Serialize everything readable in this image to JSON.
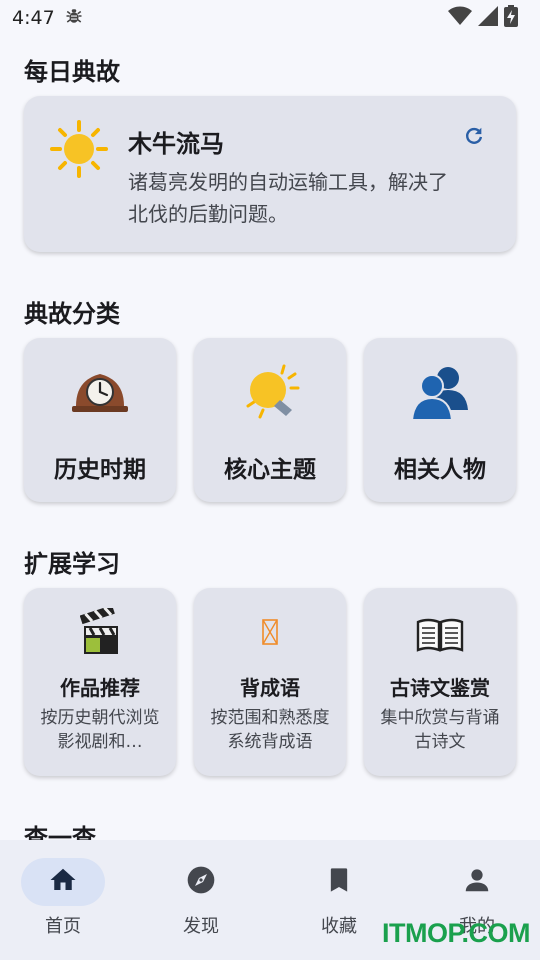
{
  "status_bar": {
    "time": "4:47",
    "icons": [
      "bug-icon",
      "wifi-icon",
      "signal-icon",
      "battery-charging-icon"
    ]
  },
  "daily": {
    "section_title": "每日典故",
    "title": "木牛流马",
    "description": "诸葛亮发明的自动运输工具，解决了北伐的后勤问题。",
    "icon": "sun-icon",
    "refresh_icon": "refresh-icon"
  },
  "categories": {
    "section_title": "典故分类",
    "items": [
      {
        "label": "历史时期",
        "icon": "mantel-clock-icon"
      },
      {
        "label": "核心主题",
        "icon": "light-bulb-icon"
      },
      {
        "label": "相关人物",
        "icon": "people-icon"
      }
    ]
  },
  "extended": {
    "section_title": "扩展学习",
    "items": [
      {
        "label": "作品推荐",
        "description": "按历史朝代浏览影视剧和…",
        "icon": "clapper-board-icon"
      },
      {
        "label": "背成语",
        "description": "按范围和熟悉度系统背成语",
        "icon": "hourglass-icon"
      },
      {
        "label": "古诗文鉴赏",
        "description": "集中欣赏与背诵古诗文",
        "icon": "open-book-icon"
      }
    ]
  },
  "lookup": {
    "section_title": "查一查"
  },
  "bottom_nav": {
    "items": [
      {
        "label": "首页",
        "icon": "home-icon",
        "active": true
      },
      {
        "label": "发现",
        "icon": "compass-icon",
        "active": false
      },
      {
        "label": "收藏",
        "icon": "bookmark-icon",
        "active": false
      },
      {
        "label": "我的",
        "icon": "person-icon",
        "active": false
      }
    ]
  },
  "watermark": "ITMOP.COM",
  "colors": {
    "background": "#f6f7fc",
    "card": "#e1e3ec",
    "accent": "#1f5fa8",
    "nav_active": "#d9e2f5"
  }
}
